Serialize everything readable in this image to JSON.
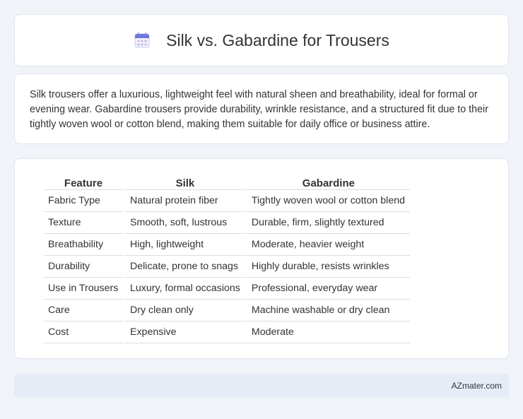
{
  "header": {
    "icon": "calendar-icon",
    "title": "Silk vs. Gabardine for Trousers"
  },
  "description": "Silk trousers offer a luxurious, lightweight feel with natural sheen and breathability, ideal for formal or evening wear. Gabardine trousers provide durability, wrinkle resistance, and a structured fit due to their tightly woven wool or cotton blend, making them suitable for daily office or business attire.",
  "table": {
    "headers": [
      "Feature",
      "Silk",
      "Gabardine"
    ],
    "rows": [
      [
        "Fabric Type",
        "Natural protein fiber",
        "Tightly woven wool or cotton blend"
      ],
      [
        "Texture",
        "Smooth, soft, lustrous",
        "Durable, firm, slightly textured"
      ],
      [
        "Breathability",
        "High, lightweight",
        "Moderate, heavier weight"
      ],
      [
        "Durability",
        "Delicate, prone to snags",
        "Highly durable, resists wrinkles"
      ],
      [
        "Use in Trousers",
        "Luxury, formal occasions",
        "Professional, everyday wear"
      ],
      [
        "Care",
        "Dry clean only",
        "Machine washable or dry clean"
      ],
      [
        "Cost",
        "Expensive",
        "Moderate"
      ]
    ]
  },
  "footer": {
    "site": "AZmater.com"
  },
  "colors": {
    "background": "#f0f3f8",
    "card": "#ffffff",
    "footer_bar": "#e6ecf6",
    "icon_accent": "#6f78d6"
  }
}
